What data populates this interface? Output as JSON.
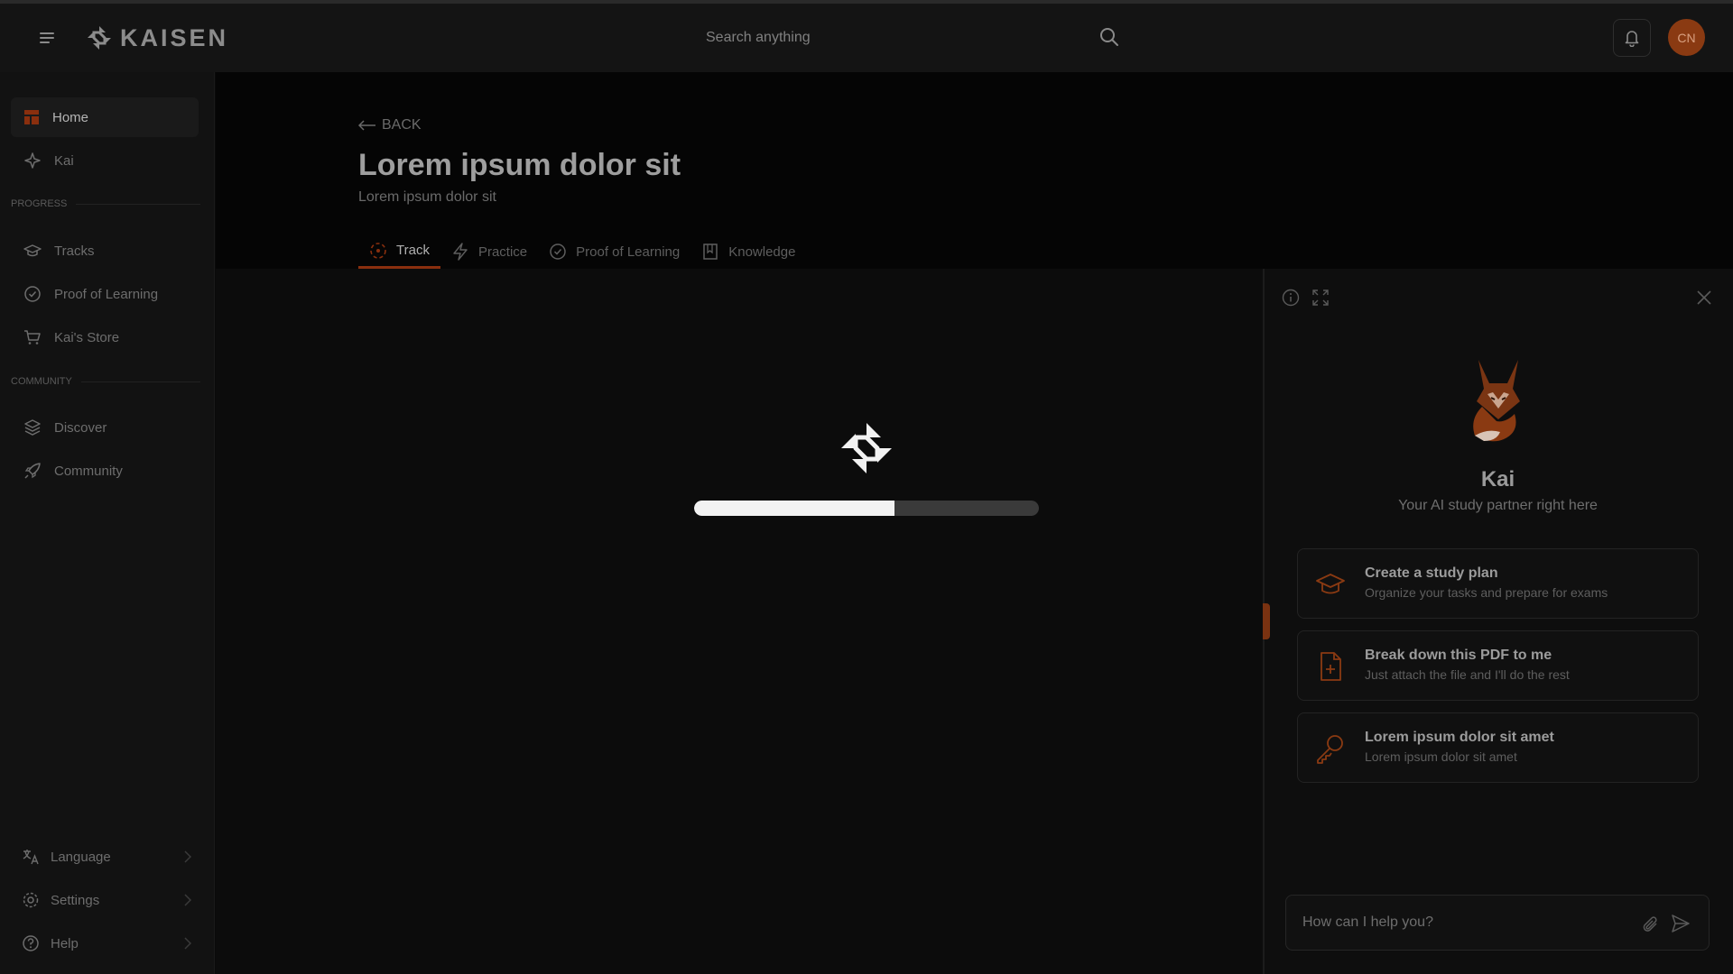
{
  "app": {
    "brand": "KAISEN"
  },
  "header": {
    "search_placeholder": "Search anything",
    "avatar_initials": "CN"
  },
  "sidebar": {
    "primary": [
      {
        "label": "Home",
        "icon": "home-icon",
        "active": true
      },
      {
        "label": "Kai",
        "icon": "sparkle-icon"
      }
    ],
    "progress_label": "PROGRESS",
    "progress": [
      {
        "label": "Tracks",
        "icon": "graduation-cap-icon"
      },
      {
        "label": "Proof of Learning",
        "icon": "check-circle-icon"
      },
      {
        "label": "Kai's Store",
        "icon": "cart-icon"
      }
    ],
    "community_label": "COMMUNITY",
    "community": [
      {
        "label": "Discover",
        "icon": "layers-icon"
      },
      {
        "label": "Community",
        "icon": "rocket-icon"
      }
    ],
    "bottom": [
      {
        "label": "Language",
        "icon": "translate-icon"
      },
      {
        "label": "Settings",
        "icon": "gear-icon"
      },
      {
        "label": "Help",
        "icon": "help-icon"
      }
    ]
  },
  "page": {
    "back_label": "BACK",
    "title": "Lorem ipsum dolor sit",
    "subtitle": "Lorem ipsum dolor sit",
    "tabs": [
      {
        "label": "Track",
        "icon": "track-icon",
        "active": true
      },
      {
        "label": "Practice",
        "icon": "bolt-icon"
      },
      {
        "label": "Proof of Learning",
        "icon": "check-circle-icon"
      },
      {
        "label": "Knowledge",
        "icon": "book-icon"
      }
    ]
  },
  "loader": {
    "progress": 0.58
  },
  "assistant": {
    "name": "Kai",
    "tagline": "Your AI study partner right here",
    "suggestions": [
      {
        "title": "Create a study plan",
        "subtitle": "Organize your tasks and prepare for exams",
        "icon": "graduation-cap-icon"
      },
      {
        "title": "Break down this PDF to me",
        "subtitle": "Just attach the file and I'll do the rest",
        "icon": "file-plus-icon"
      },
      {
        "title": "Lorem ipsum dolor sit amet",
        "subtitle": "Lorem ipsum dolor sit amet",
        "icon": "key-icon"
      }
    ],
    "input_placeholder": "How can I help you?"
  },
  "colors": {
    "accent": "#8a2f0e",
    "avatar_bg": "#8a3a12"
  }
}
